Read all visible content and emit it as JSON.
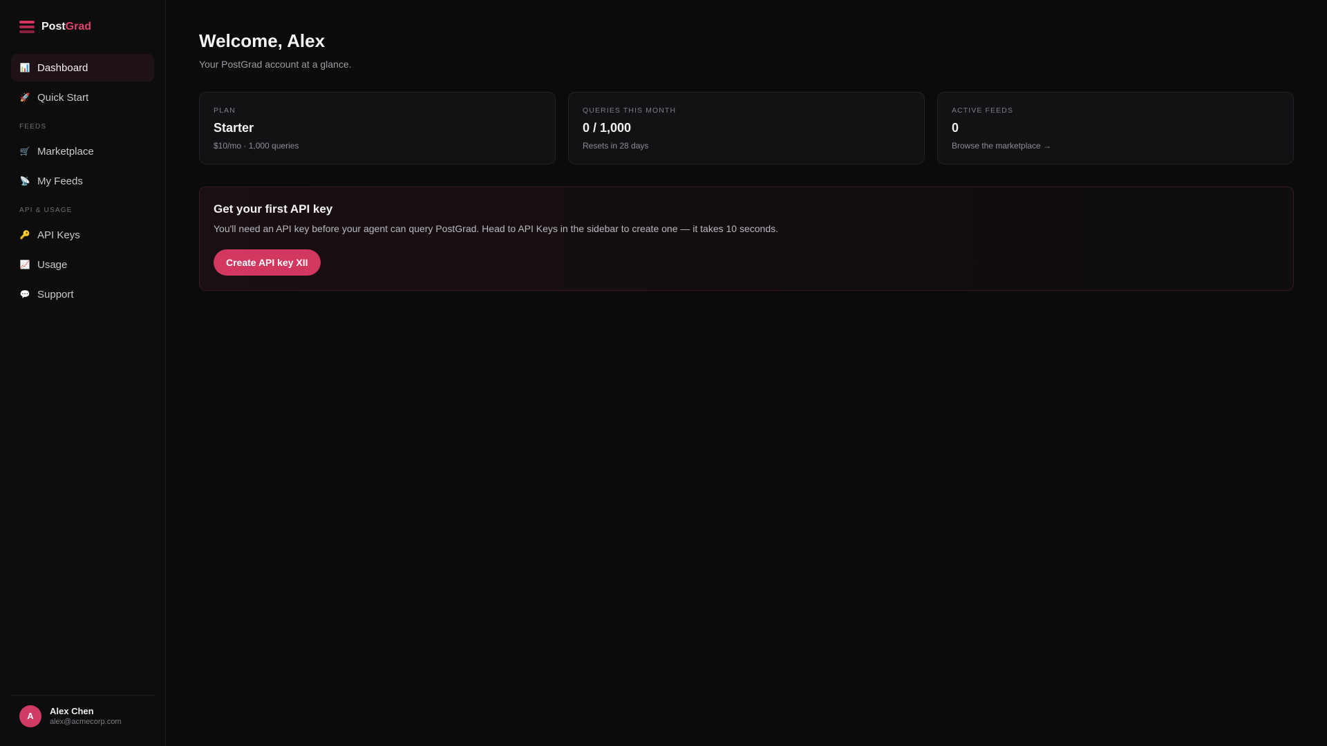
{
  "brand": {
    "name_primary": "Post",
    "name_accent": "Grad"
  },
  "sidebar": {
    "items_top": [
      {
        "label": "Dashboard",
        "icon": "📊"
      },
      {
        "label": "Quick Start",
        "icon": "🚀"
      }
    ],
    "section_feeds": "FEEDS",
    "items_feeds": [
      {
        "label": "Marketplace",
        "icon": "🛒"
      },
      {
        "label": "My Feeds",
        "icon": "📡"
      }
    ],
    "section_api": "API & USAGE",
    "items_api": [
      {
        "label": "API Keys",
        "icon": "🔑"
      },
      {
        "label": "Usage",
        "icon": "📈"
      },
      {
        "label": "Support",
        "icon": "💬"
      }
    ],
    "user": {
      "initial": "A",
      "name": "Alex Chen",
      "email": "alex@acmecorp.com"
    }
  },
  "main": {
    "title": "Welcome, Alex",
    "subtitle": "Your PostGrad account at a glance.",
    "stats": [
      {
        "label": "PLAN",
        "value": "Starter",
        "sub": "$10/mo · 1,000 queries"
      },
      {
        "label": "QUERIES THIS MONTH",
        "value": "0 / 1,000",
        "sub": "Resets in 28 days"
      },
      {
        "label": "ACTIVE FEEDS",
        "value": "0",
        "sub": "Browse the marketplace →"
      }
    ],
    "callout": {
      "title": "Get your first API key",
      "text": "You'll need an API key before your agent can query PostGrad. Head to API Keys in the sidebar to create one — it takes 10 seconds.",
      "button": "Create API key XII"
    }
  },
  "colors": {
    "accent": "#d2385f",
    "background": "#0b0b0c",
    "sidebar": "#0d0d0e",
    "card": "#121214"
  }
}
